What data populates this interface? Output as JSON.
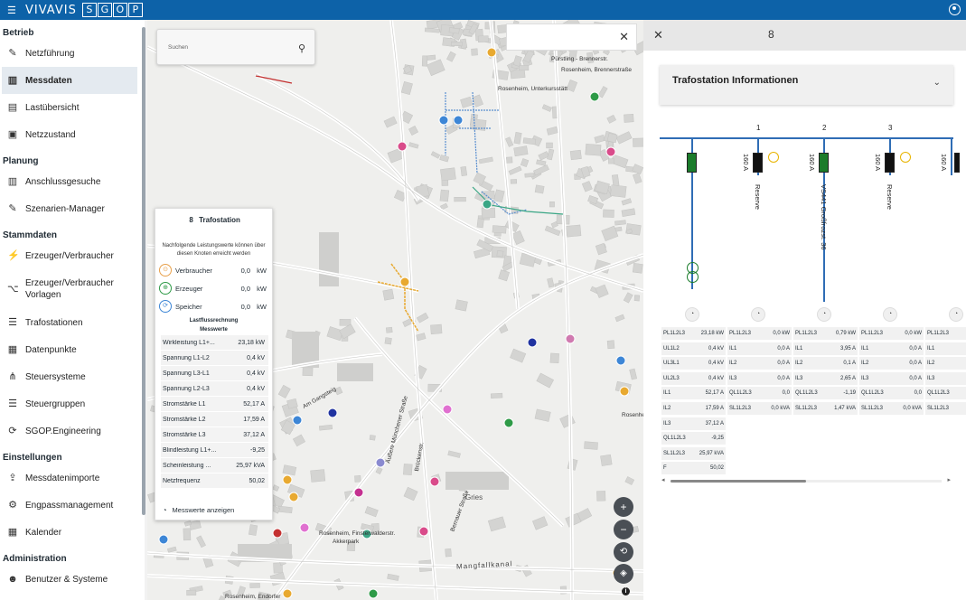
{
  "topbar": {
    "brand": "VIVAVIS",
    "brand_letters": [
      "S",
      "G",
      "O",
      "P"
    ]
  },
  "sidebar": {
    "sections": [
      {
        "title": "Betrieb",
        "items": [
          {
            "label": "Netzführung",
            "icon": "edit-icon"
          },
          {
            "label": "Messdaten",
            "icon": "map-icon",
            "active": true
          },
          {
            "label": "Lastübersicht",
            "icon": "chart-icon"
          },
          {
            "label": "Netzzustand",
            "icon": "status-icon"
          }
        ]
      },
      {
        "title": "Planung",
        "items": [
          {
            "label": "Anschlussgesuche",
            "icon": "map-icon"
          },
          {
            "label": "Szenarien-Manager",
            "icon": "edit-icon"
          }
        ]
      },
      {
        "title": "Stammdaten",
        "items": [
          {
            "label": "Erzeuger/Verbraucher",
            "icon": "plug-icon"
          },
          {
            "label": "Erzeuger/Verbraucher Vorlagen",
            "icon": "hierarchy-icon"
          },
          {
            "label": "Trafostationen",
            "icon": "list-icon"
          },
          {
            "label": "Datenpunkte",
            "icon": "grid-icon"
          },
          {
            "label": "Steuersysteme",
            "icon": "network-icon"
          },
          {
            "label": "Steuergruppen",
            "icon": "list-icon"
          },
          {
            "label": "SGOP.Engineering",
            "icon": "refresh-icon"
          }
        ]
      },
      {
        "title": "Einstellungen",
        "items": [
          {
            "label": "Messdatenimporte",
            "icon": "upload-icon"
          },
          {
            "label": "Engpassmanagement",
            "icon": "gear-icon"
          },
          {
            "label": "Kalender",
            "icon": "calendar-icon"
          }
        ]
      },
      {
        "title": "Administration",
        "items": [
          {
            "label": "Benutzer & Systeme",
            "icon": "users-icon"
          }
        ]
      }
    ]
  },
  "map": {
    "search_placeholder": "Suchen",
    "labels": [
      "Pürstling - Brennerstr.",
      "Rosenheim, Brennerstraße",
      "Rosenheim, Unterkursstätt",
      "Rosenheim, Finsterwalderstr.",
      "Akkerpark",
      "Gries",
      "Mangfallkanal",
      "Rosenheim, Endorfer",
      "Am Gangsteig",
      "Äußere Münchener Straße",
      "Brückenstr.",
      "Bernauer Straße",
      "Rosenheim, Münch"
    ],
    "popup": {
      "title": "Trafostation",
      "description": "Nachfolgende Leistungswerte können über diesen Knoten erreicht werden",
      "power_rows": [
        {
          "name": "Verbraucher",
          "value": "0,0",
          "unit": "kW",
          "color": "#e8a04a"
        },
        {
          "name": "Erzeuger",
          "value": "0,0",
          "unit": "kW",
          "color": "#2e9a47"
        },
        {
          "name": "Speicher",
          "value": "0,0",
          "unit": "kW",
          "color": "#3d86d6"
        }
      ],
      "section1": "Lastflussrechnung",
      "section2": "Messwerte",
      "measurements": [
        {
          "name": "Wirkleistung L1+...",
          "value": "23,18 kW"
        },
        {
          "name": "Spannung L1-L2",
          "value": "0,4 kV"
        },
        {
          "name": "Spannung L3-L1",
          "value": "0,4 kV"
        },
        {
          "name": "Spannung L2-L3",
          "value": "0,4 kV"
        },
        {
          "name": "Stromstärke L1",
          "value": "52,17 A"
        },
        {
          "name": "Stromstärke L2",
          "value": "17,59 A"
        },
        {
          "name": "Stromstärke L3",
          "value": "37,12 A"
        },
        {
          "name": "Blindleistung L1+...",
          "value": "-9,25"
        },
        {
          "name": "Scheinleistung ...",
          "value": "25,97 kVA"
        },
        {
          "name": "Netzfrequenz",
          "value": "50,02"
        }
      ],
      "button": "Messwerte anzeigen"
    }
  },
  "panel": {
    "card_title": "Trafostation Informationen",
    "diagram": {
      "bus_numbers": [
        "1",
        "2",
        "3"
      ],
      "fuse_labels": [
        "160 A",
        "160 A",
        "160 A",
        "160 A"
      ],
      "feeder_names": [
        "Reserve",
        "VS441 Großfrozst. 36",
        "Reserve"
      ]
    },
    "tables": [
      [
        {
          "k": "PL1L2L3",
          "v": "23,18 kW"
        },
        {
          "k": "UL1L2",
          "v": "0,4 kV"
        },
        {
          "k": "UL3L1",
          "v": "0,4 kV"
        },
        {
          "k": "UL2L3",
          "v": "0,4 kV"
        },
        {
          "k": "IL1",
          "v": "52,17 A"
        },
        {
          "k": "IL2",
          "v": "17,59 A"
        },
        {
          "k": "IL3",
          "v": "37,12 A"
        },
        {
          "k": "QL1L2L3",
          "v": "-9,25"
        },
        {
          "k": "SL1L2L3",
          "v": "25,97 kVA"
        },
        {
          "k": "F",
          "v": "50,02"
        }
      ],
      [
        {
          "k": "PL1L2L3",
          "v": "0,0 kW"
        },
        {
          "k": "IL1",
          "v": "0,0 A"
        },
        {
          "k": "IL2",
          "v": "0,0 A"
        },
        {
          "k": "IL3",
          "v": "0,0 A"
        },
        {
          "k": "QL1L2L3",
          "v": "0,0"
        },
        {
          "k": "SL1L2L3",
          "v": "0,0 kVA"
        }
      ],
      [
        {
          "k": "PL1L2L3",
          "v": "0,79 kW"
        },
        {
          "k": "IL1",
          "v": "3,95 A"
        },
        {
          "k": "IL2",
          "v": "0,1 A"
        },
        {
          "k": "IL3",
          "v": "2,65 A"
        },
        {
          "k": "QL1L2L3",
          "v": "-1,19"
        },
        {
          "k": "SL1L2L3",
          "v": "1,47 kVA"
        }
      ],
      [
        {
          "k": "PL1L2L3",
          "v": "0,0 kW"
        },
        {
          "k": "IL1",
          "v": "0,0 A"
        },
        {
          "k": "IL2",
          "v": "0,0 A"
        },
        {
          "k": "IL3",
          "v": "0,0 A"
        },
        {
          "k": "QL1L2L3",
          "v": "0,0"
        },
        {
          "k": "SL1L2L3",
          "v": "0,0 kVA"
        }
      ],
      [
        {
          "k": "PL1L2L3",
          "v": ""
        },
        {
          "k": "IL1",
          "v": ""
        },
        {
          "k": "IL2",
          "v": ""
        },
        {
          "k": "IL3",
          "v": ""
        },
        {
          "k": "QL1L2L3",
          "v": ""
        },
        {
          "k": "SL1L2L3",
          "v": ""
        }
      ]
    ]
  },
  "colors": {
    "brand": "#0d62a8",
    "bus": "#2f6db5",
    "fuse_active": "#1b7c2b",
    "fuse_reserve": "#111111",
    "ring": "#e8b400"
  }
}
